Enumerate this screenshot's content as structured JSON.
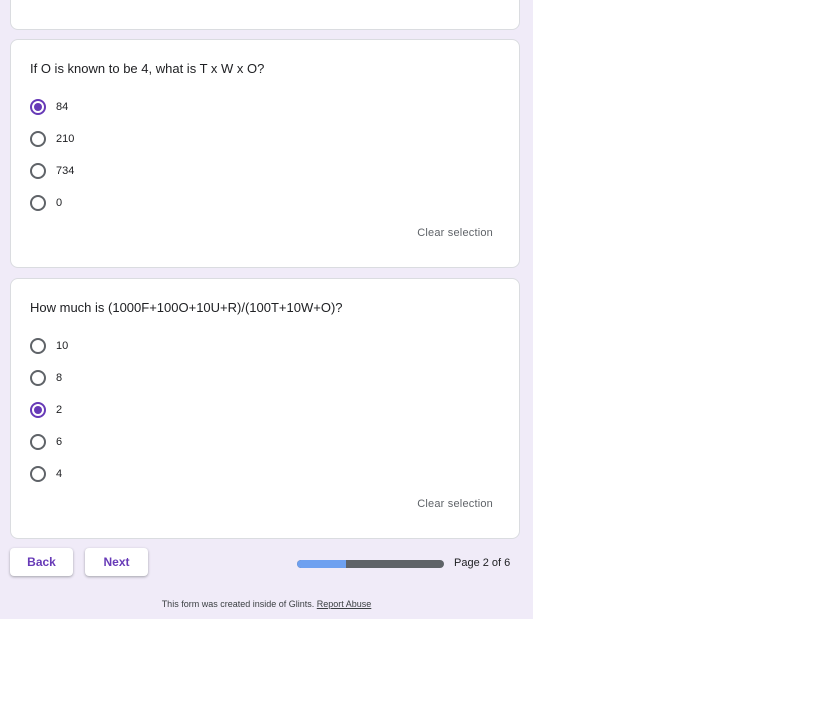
{
  "questions": [
    {
      "title": "If O is known to be 4, what is T x W x O?",
      "options": [
        "84",
        "210",
        "734",
        "0"
      ],
      "selected_index": 0,
      "clear_label": "Clear selection"
    },
    {
      "title": "How much is (1000F+100O+10U+R)/(100T+10W+O)?",
      "options": [
        "10",
        "8",
        "2",
        "6",
        "4"
      ],
      "selected_index": 2,
      "clear_label": "Clear selection"
    }
  ],
  "navigation": {
    "back_label": "Back",
    "next_label": "Next",
    "progress_fraction": 0.33,
    "page_indicator": "Page 2 of 6"
  },
  "footer": {
    "text": "This form was created inside of Glints.",
    "link_label": "Report Abuse"
  },
  "colors": {
    "page_background": "#f0ebf8",
    "accent": "#673ab7",
    "progress_fill": "#6ea0f0",
    "progress_track": "#5f6368"
  }
}
